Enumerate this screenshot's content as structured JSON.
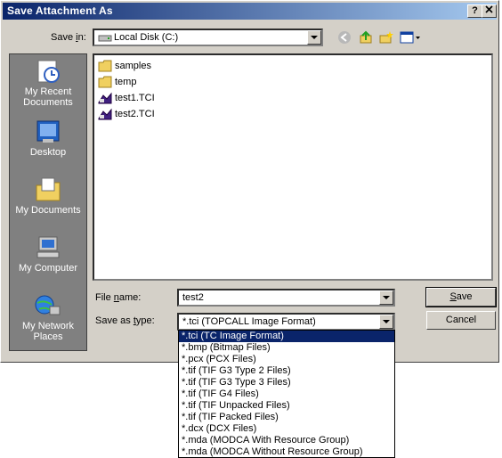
{
  "window": {
    "title": "Save Attachment As",
    "help_label": "?",
    "close_label": "X"
  },
  "save_in": {
    "label_pre": "Save ",
    "label_key": "i",
    "label_post": "n:",
    "value": "Local Disk (C:)"
  },
  "places": [
    {
      "label": "My Recent Documents",
      "icon": "recent-documents-icon"
    },
    {
      "label": "Desktop",
      "icon": "desktop-icon"
    },
    {
      "label": "My Documents",
      "icon": "my-documents-icon"
    },
    {
      "label": "My Computer",
      "icon": "my-computer-icon"
    },
    {
      "label": "My Network Places",
      "icon": "network-places-icon"
    }
  ],
  "files": [
    {
      "name": "samples",
      "type": "folder"
    },
    {
      "name": "temp",
      "type": "folder"
    },
    {
      "name": "test1.TCI",
      "type": "tci"
    },
    {
      "name": "test2.TCI",
      "type": "tci"
    }
  ],
  "file_name": {
    "label_pre": "File ",
    "label_key": "n",
    "label_post": "ame:",
    "value": "test2"
  },
  "save_type": {
    "label_pre": "Save as ",
    "label_key": "t",
    "label_post": "ype:",
    "value": "*.tci (TOPCALL Image Format)"
  },
  "buttons": {
    "save_key": "S",
    "save_rest": "ave",
    "cancel": "Cancel"
  },
  "type_options": [
    "*.tci (TC Image Format)",
    "*.bmp (Bitmap Files)",
    "*.pcx (PCX Files)",
    "*.tif (TIF G3 Type 2 Files)",
    "*.tif (TIF G3 Type 3 Files)",
    "*.tif (TIF G4 Files)",
    "*.tif (TIF Unpacked Files)",
    "*.tif (TIF Packed Files)",
    "*.dcx (DCX Files)",
    "*.mda (MODCA With Resource Group)",
    "*.mda (MODCA Without Resource Group)"
  ],
  "selected_option_index": 0
}
